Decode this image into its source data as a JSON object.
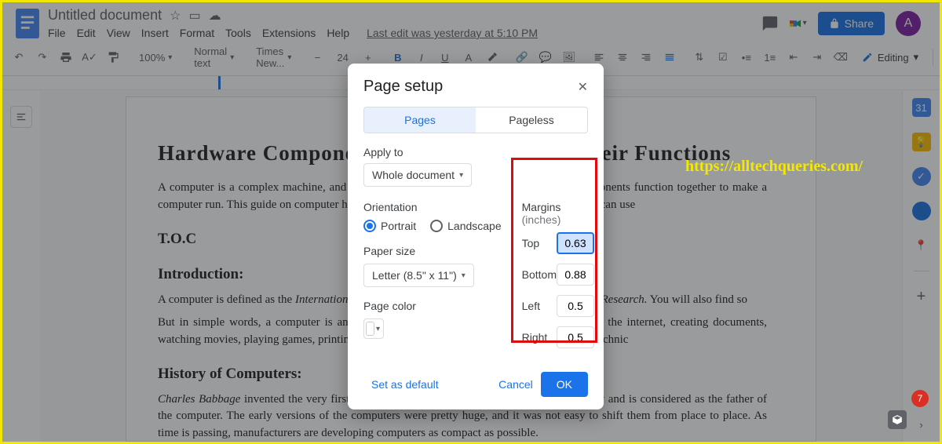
{
  "header": {
    "doc_title": "Untitled document",
    "menus": [
      "File",
      "Edit",
      "View",
      "Insert",
      "Format",
      "Tools",
      "Extensions",
      "Help"
    ],
    "last_edit": "Last edit was yesterday at 5:10 PM",
    "share_label": "Share",
    "avatar_letter": "A"
  },
  "toolbar": {
    "zoom": "100%",
    "style": "Normal text",
    "font": "Times New...",
    "size": "24",
    "editing_label": "Editing"
  },
  "document": {
    "title": "Hardware Components of a Computer and their Functions",
    "intro_p": "A computer is a complex machine, and like other machines, it contains multiple parts/components function together to make a computer run. This guide on computer hardware will help you identify these parts easily. You can use",
    "toc_label": "T.O.C",
    "intro_head": "Introduction:",
    "intro2_p1": "A computer is defined as the",
    "intro2_em": "International Journal of Scientific Engineering and Educational Research.",
    "intro2_p2": " You will also find so",
    "simple_p": "But in simple words, a computer is an electronic device that performs tasks like browsing the internet, creating documents, watching movies, playing games, printing documents, saving photos, storing data, and other technic",
    "history_head": "History of Computers:",
    "history_em": "Charles Babbage",
    "history_p": " invented the very first desktop PC (Personal Computer) in the 19th century and is considered as the father of the computer. The early versions of the computers were pretty huge, and it was not easy to shift them from place to place. As time is passing, manufacturers are developing computers as compact as possible."
  },
  "dialog": {
    "title": "Page setup",
    "tab_pages": "Pages",
    "tab_pageless": "Pageless",
    "apply_to_label": "Apply to",
    "apply_to_value": "Whole document",
    "orientation_label": "Orientation",
    "portrait": "Portrait",
    "landscape": "Landscape",
    "paper_size_label": "Paper size",
    "paper_size_value": "Letter (8.5\" x 11\")",
    "page_color_label": "Page color",
    "margins_label": "Margins",
    "margins_unit": "(inches)",
    "top_label": "Top",
    "top_value": "0.63",
    "bottom_label": "Bottom",
    "bottom_value": "0.88",
    "left_label": "Left",
    "left_value": "0.5",
    "right_label": "Right",
    "right_value": "0.5",
    "set_default": "Set as default",
    "cancel": "Cancel",
    "ok": "OK"
  },
  "watermark": "https://alltechqueries.com/",
  "badge": "7"
}
